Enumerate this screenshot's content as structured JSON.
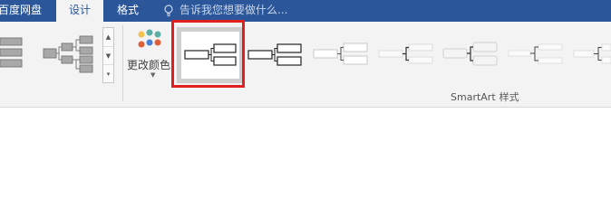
{
  "tabs": [
    {
      "label": "百度网盘"
    },
    {
      "label": "设计"
    },
    {
      "label": "格式"
    }
  ],
  "tell_me": {
    "placeholder": "告诉我您想要做什么...",
    "icon": "lightbulb-icon"
  },
  "change_colors": {
    "label": "更改颜色",
    "icon": "color-palette-icon"
  },
  "smartart_styles": {
    "group_label_en": "SmartArt",
    "group_label_zh": "样式",
    "selected_index": 0
  },
  "gallery": {
    "scroll": [
      "▲",
      "▼",
      "▾"
    ]
  },
  "colors": {
    "tabbar": "#2b579a",
    "ribbon": "#f3f3f3",
    "highlight": "#e02020",
    "palette": [
      "#f2c14e",
      "#5bb0a5",
      "#e0603a",
      "#4a7fd1"
    ]
  }
}
